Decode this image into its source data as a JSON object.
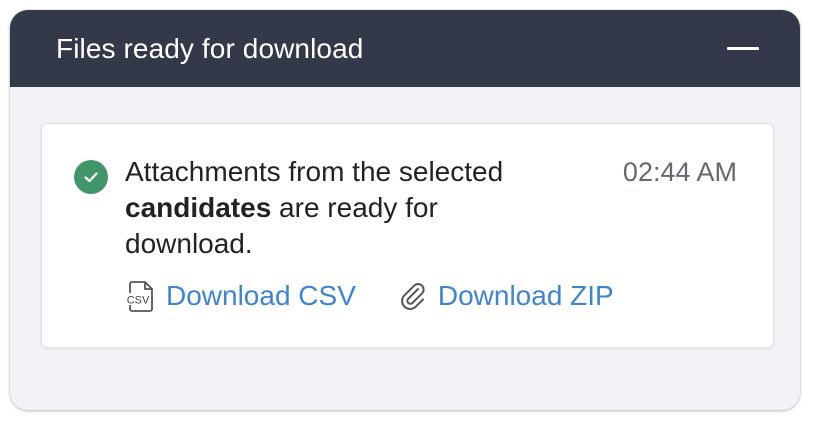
{
  "header": {
    "title": "Files ready for download",
    "minimize_icon": "minus-icon"
  },
  "notification": {
    "status_icon": "check-circle-icon",
    "status_color": "#41956a",
    "message_part1": "Attachments from the selected ",
    "message_bold": "candidates",
    "message_part2": " are ready for download.",
    "timestamp": "02:44 AM",
    "actions": [
      {
        "label": "Download CSV",
        "icon": "csv-file-icon"
      },
      {
        "label": "Download ZIP",
        "icon": "paperclip-icon"
      }
    ]
  },
  "colors": {
    "header_bg": "#333949",
    "link": "#3f83d4",
    "panel_bg": "#f2f3f6"
  }
}
